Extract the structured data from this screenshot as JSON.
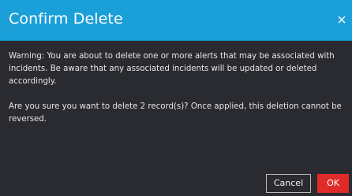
{
  "dialog": {
    "title": "Confirm Delete",
    "close_icon": "close-icon",
    "warning_text": "Warning: You are about to delete one or more alerts that may be associated with incidents. Be aware that any associated incidents will be updated or deleted accordingly.",
    "confirm_text": "Are you sure you want to delete 2 record(s)? Once applied, this deletion cannot be reversed.",
    "cancel_label": "Cancel",
    "ok_label": "OK"
  },
  "colors": {
    "header": "#1a9fd8",
    "background": "#2a2b30",
    "ok_button": "#e12a2a"
  }
}
